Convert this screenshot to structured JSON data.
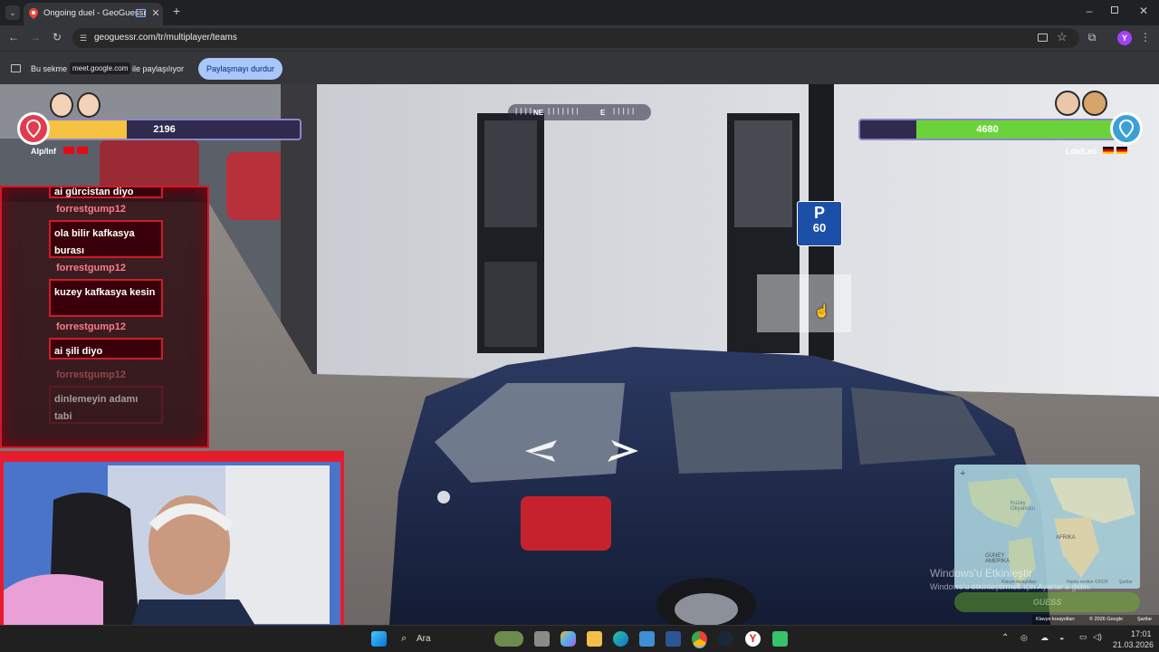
{
  "browser": {
    "tab_title": "Ongoing duel - GeoGuessr",
    "url": "geoguessr.com/tr/multiplayer/teams",
    "profile_initial": "Y"
  },
  "sharing_bar": {
    "text_before": "Bu sekme",
    "domain": "meet.google.com",
    "text_after": "ile paylaşılıyor",
    "stop_button": "Paylaşmayı durdur"
  },
  "game": {
    "compass_labels": [
      "NE",
      "E"
    ],
    "left_team": {
      "health": 2196,
      "name": "Alp/Inf",
      "health_fraction": 0.36,
      "color": "#f5c242"
    },
    "right_team": {
      "health": 4680,
      "name": "Lde/Leo",
      "health_fraction": 0.78,
      "color": "#6bd33a"
    },
    "parking_sign": {
      "letter": "P",
      "number": "60"
    },
    "minimap": {
      "labels": [
        "Kuzey Okyanusu",
        "AFRIKA",
        "GÜNEY AMERİKA"
      ],
      "footer": [
        "Klavye kısayolları",
        "Harita verileri ©2026",
        "Şartlar"
      ],
      "guess_button": "GUESS"
    },
    "footer": {
      "left": "Klavye kısayolları",
      "mid": "© 2026 Google",
      "right": "Şartlar"
    }
  },
  "chat": {
    "messages": [
      {
        "author": "",
        "text": "ai gürcistan diyo"
      },
      {
        "author": "forrestgump12",
        "text": "ola bilir kafkasya burası"
      },
      {
        "author": "forrestgump12",
        "text": "kuzey kafkasya kesin"
      },
      {
        "author": "forrestgump12",
        "text": "ai şili diyo"
      },
      {
        "author": "forrestgump12",
        "text": "dinlemeyin adamı tabi"
      }
    ]
  },
  "watermark": {
    "line1": "Windows'u Etkinleştir",
    "line2": "Windows'u etkinleştirmek için Ayarlar'a gidin."
  },
  "taskbar": {
    "search_placeholder": "Ara",
    "time": "17:01",
    "date": "21.03.2026"
  },
  "colors": {
    "chat_border": "#d11a2a",
    "chat_author": "#ff7a8a",
    "sharing_button_bg": "#a8c7fa"
  }
}
